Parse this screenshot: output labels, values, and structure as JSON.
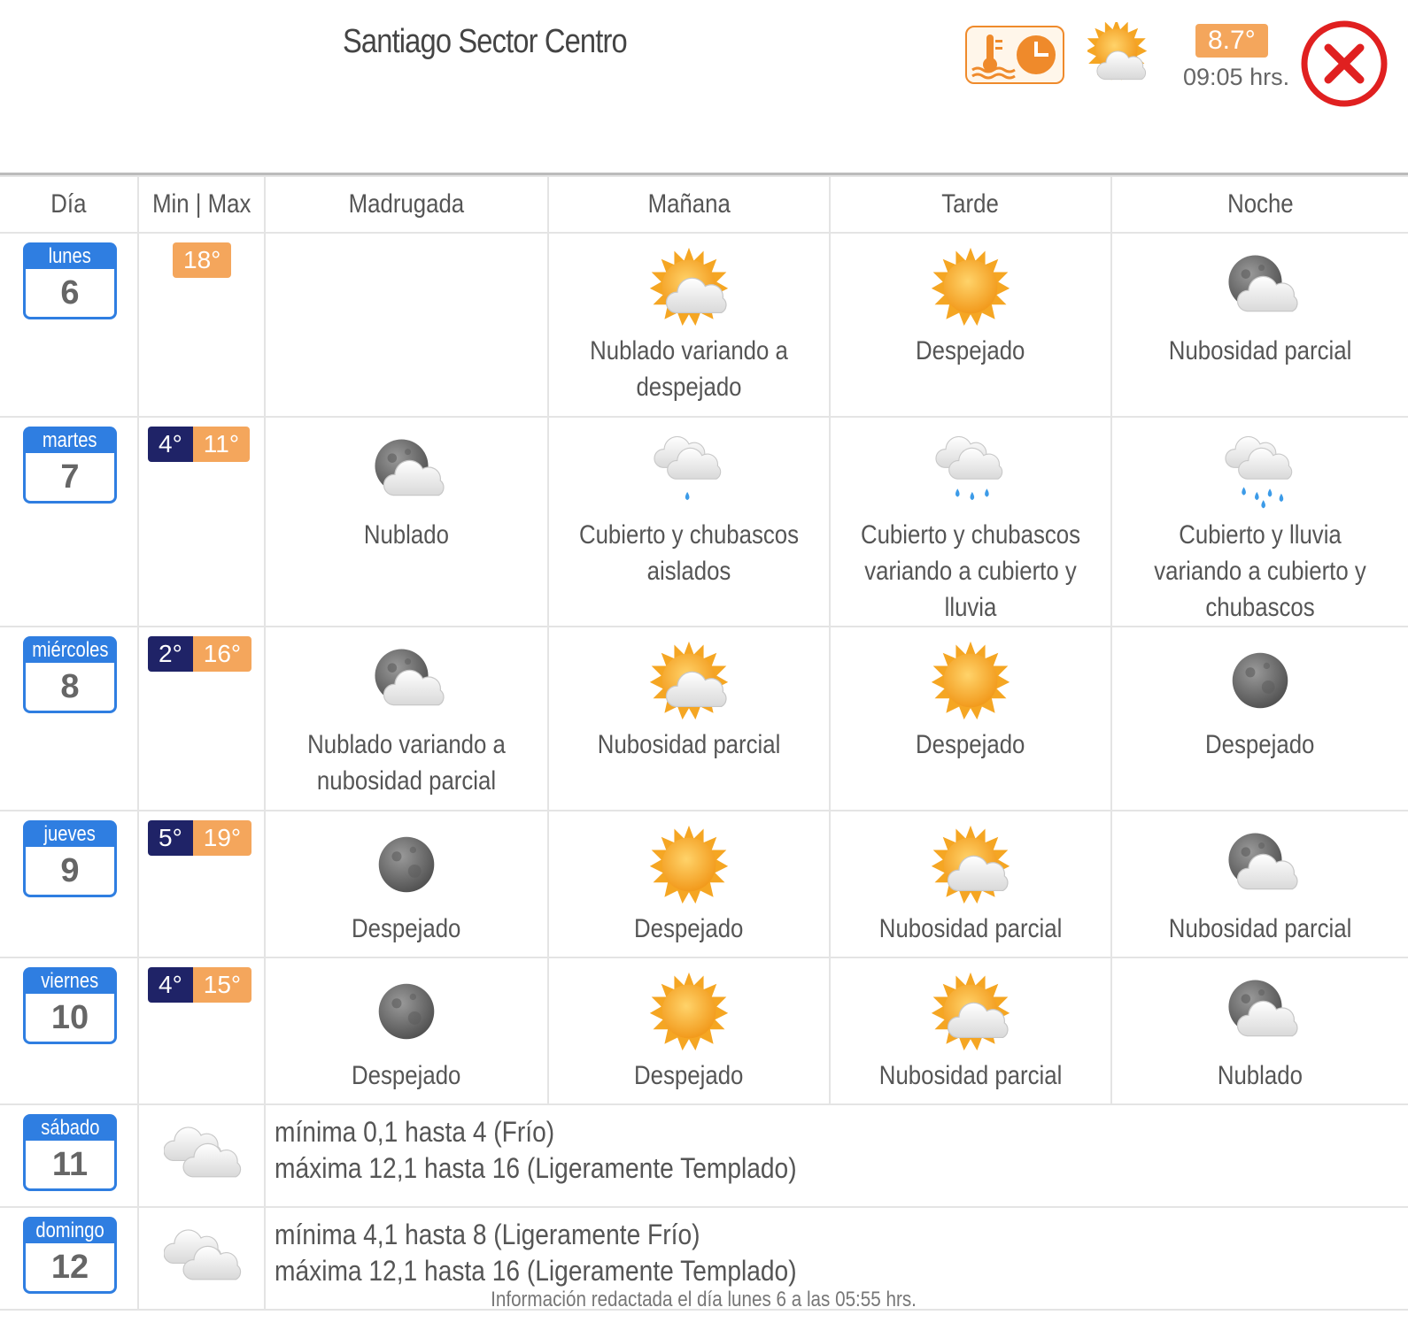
{
  "header": {
    "title": "Santiago Sector Centro",
    "current_temp": "8.7°",
    "current_time": "09:05 hrs.",
    "current_icon": "sun-cloud-icon",
    "history_icon": "thermometer-clock-icon",
    "close_icon": "close-icon"
  },
  "columns": [
    "Día",
    "Min | Max",
    "Madrugada",
    "Mañana",
    "Tarde",
    "Noche"
  ],
  "days": [
    {
      "weekday": "lunes",
      "day": "6",
      "min": "",
      "max": "18°",
      "periods": [
        {
          "icon": "",
          "text": ""
        },
        {
          "icon": "sun-cloud-icon",
          "text": "Nublado variando a despejado"
        },
        {
          "icon": "sun-icon",
          "text": "Despejado"
        },
        {
          "icon": "moon-cloud-icon",
          "text": "Nubosidad parcial"
        }
      ]
    },
    {
      "weekday": "martes",
      "day": "7",
      "min": "4°",
      "max": "11°",
      "periods": [
        {
          "icon": "moon-cloud-icon",
          "text": "Nublado"
        },
        {
          "icon": "cloud-light-rain-icon",
          "text": "Cubierto y chubascos aislados"
        },
        {
          "icon": "cloud-rain-icon",
          "text": "Cubierto y chubascos variando a cubierto y lluvia"
        },
        {
          "icon": "cloud-heavy-rain-icon",
          "text": "Cubierto y lluvia variando a cubierto y chubascos"
        }
      ]
    },
    {
      "weekday": "miércoles",
      "day": "8",
      "min": "2°",
      "max": "16°",
      "periods": [
        {
          "icon": "moon-cloud-icon",
          "text": "Nublado variando a nubosidad parcial"
        },
        {
          "icon": "sun-cloud-icon",
          "text": "Nubosidad parcial"
        },
        {
          "icon": "sun-icon",
          "text": "Despejado"
        },
        {
          "icon": "moon-icon",
          "text": "Despejado"
        }
      ]
    },
    {
      "weekday": "jueves",
      "day": "9",
      "min": "5°",
      "max": "19°",
      "periods": [
        {
          "icon": "moon-icon",
          "text": "Despejado"
        },
        {
          "icon": "sun-icon",
          "text": "Despejado"
        },
        {
          "icon": "sun-cloud-icon",
          "text": "Nubosidad parcial"
        },
        {
          "icon": "moon-cloud-icon",
          "text": "Nubosidad parcial"
        }
      ]
    },
    {
      "weekday": "viernes",
      "day": "10",
      "min": "4°",
      "max": "15°",
      "periods": [
        {
          "icon": "moon-icon",
          "text": "Despejado"
        },
        {
          "icon": "sun-icon",
          "text": "Despejado"
        },
        {
          "icon": "sun-cloud-icon",
          "text": "Nubosidad parcial"
        },
        {
          "icon": "moon-cloud-icon",
          "text": "Nublado"
        }
      ]
    }
  ],
  "extended": [
    {
      "weekday": "sábado",
      "day": "11",
      "icon": "clouds-icon",
      "min_text": "mínima 0,1 hasta 4 (Frío)",
      "max_text": "máxima 12,1 hasta 16 (Ligeramente Templado)"
    },
    {
      "weekday": "domingo",
      "day": "12",
      "icon": "clouds-icon",
      "min_text": "mínima 4,1 hasta 8 (Ligeramente Frío)",
      "max_text": "máxima 12,1 hasta 16 (Ligeramente Templado)"
    }
  ],
  "footer": "Información redactada el día lunes 6 a las 05:55 hrs.",
  "colors": {
    "accent_blue": "#2f7ee1",
    "min_bg": "#1f2367",
    "max_bg": "#f4a65c",
    "close_red": "#e02020"
  }
}
